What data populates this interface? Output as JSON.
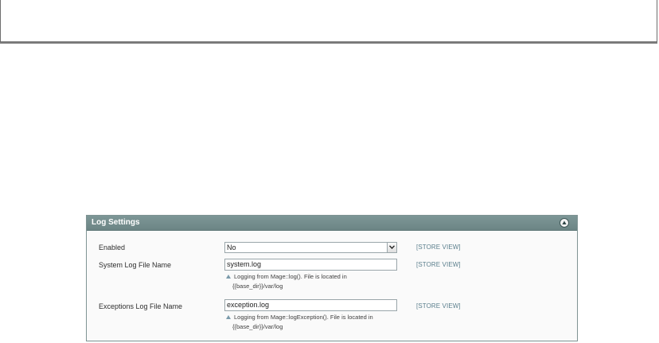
{
  "panel": {
    "title": "Log Settings",
    "collapse_icon": "chevron-up-icon"
  },
  "fields": {
    "enabled": {
      "label": "Enabled",
      "value": "No",
      "scope": "[STORE VIEW]"
    },
    "system_log": {
      "label": "System Log File Name",
      "value": "system.log",
      "scope": "[STORE VIEW]",
      "note_line1": "Logging from Mage::log(). File is located in",
      "note_line2": "{{base_dir}}/var/log"
    },
    "exception_log": {
      "label": "Exceptions Log File Name",
      "value": "exception.log",
      "scope": "[STORE VIEW]",
      "note_line1": "Logging from Mage::logException(). File is located in",
      "note_line2": "{{base_dir}}/var/log"
    }
  },
  "colors": {
    "header": "#768f8f",
    "scope_link": "#5b7f8d",
    "border": "#7f9393"
  }
}
